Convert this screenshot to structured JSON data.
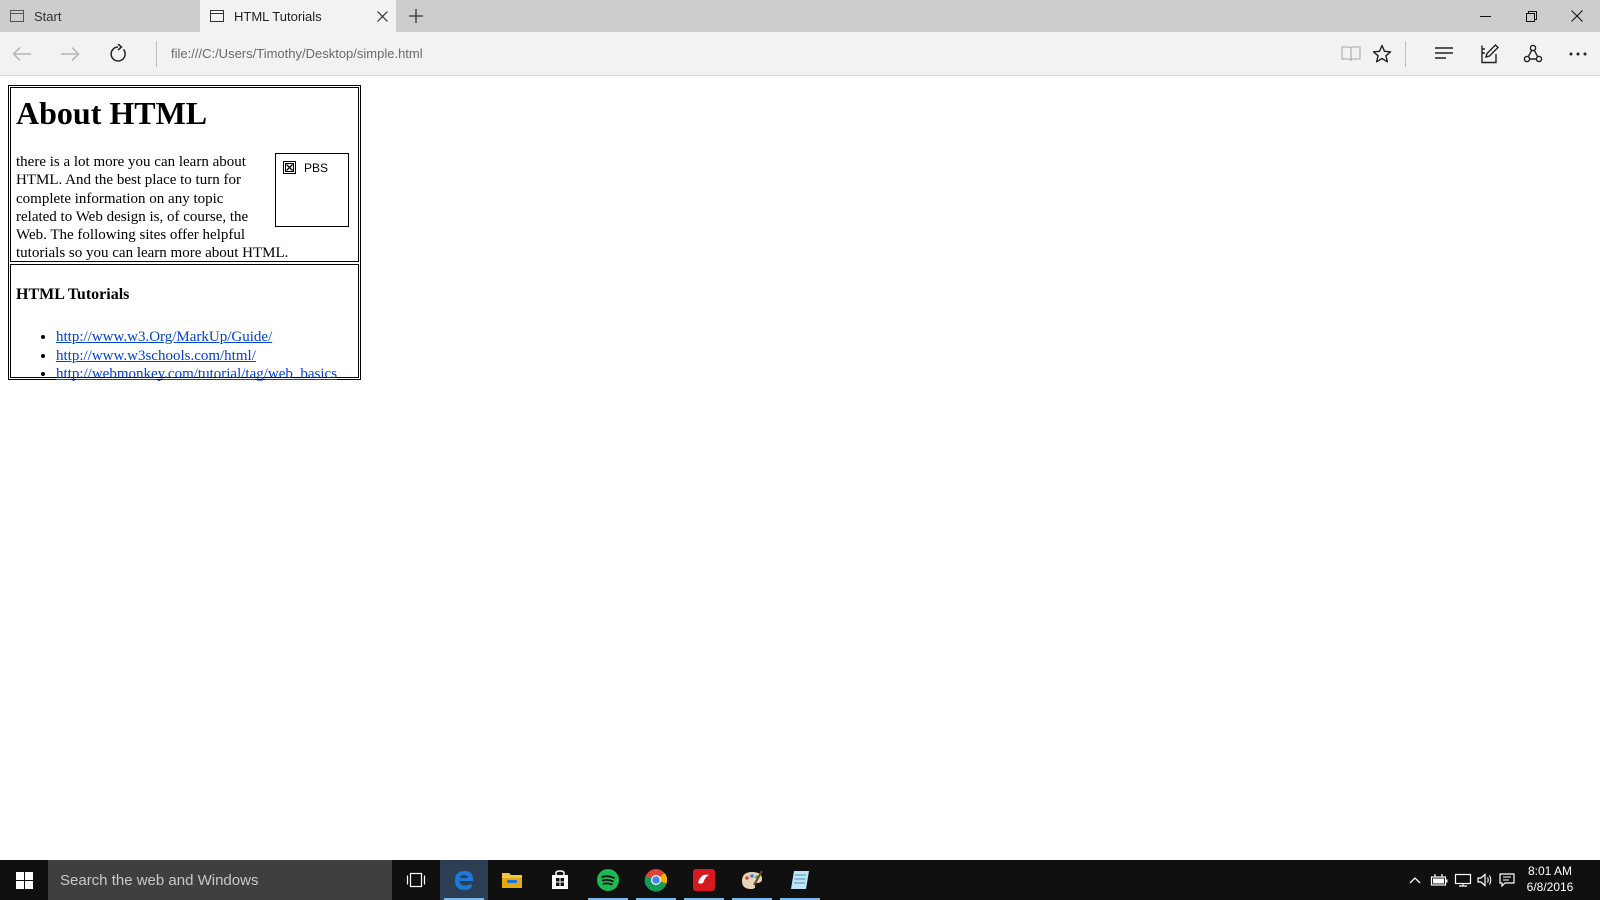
{
  "tabs": [
    {
      "label": "Start"
    },
    {
      "label": "HTML Tutorials"
    }
  ],
  "address_bar": {
    "url": "file:///C:/Users/Timothy/Desktop/simple.html"
  },
  "page": {
    "heading": "About HTML",
    "paragraph": "there is a lot more you can learn about HTML. And the best place to turn for complete information on any topic related to Web design is, of course, the Web. The following sites offer helpful tutorials so you can learn more about HTML.",
    "image_alt": "PBS",
    "tutorials_heading": "HTML Tutorials",
    "links": [
      "http://www.w3.Org/MarkUp/Guide/",
      "http://www.w3schools.com/html/",
      "http://webmonkey.com/tutorial/tag/web_basics"
    ]
  },
  "taskbar": {
    "search_placeholder": "Search the web and Windows",
    "apps": [
      "task-view",
      "edge",
      "file-explorer",
      "store",
      "spotify",
      "chrome",
      "trend-micro",
      "paint",
      "notepad"
    ],
    "clock_time": "8:01 AM",
    "clock_date": "6/8/2016"
  },
  "colors": {
    "link": "#0044cc",
    "tabstrip": "#cdcdcd",
    "toolbar": "#f2f2f2",
    "taskbar": "#101010",
    "edge_blue": "#1e78d7"
  }
}
